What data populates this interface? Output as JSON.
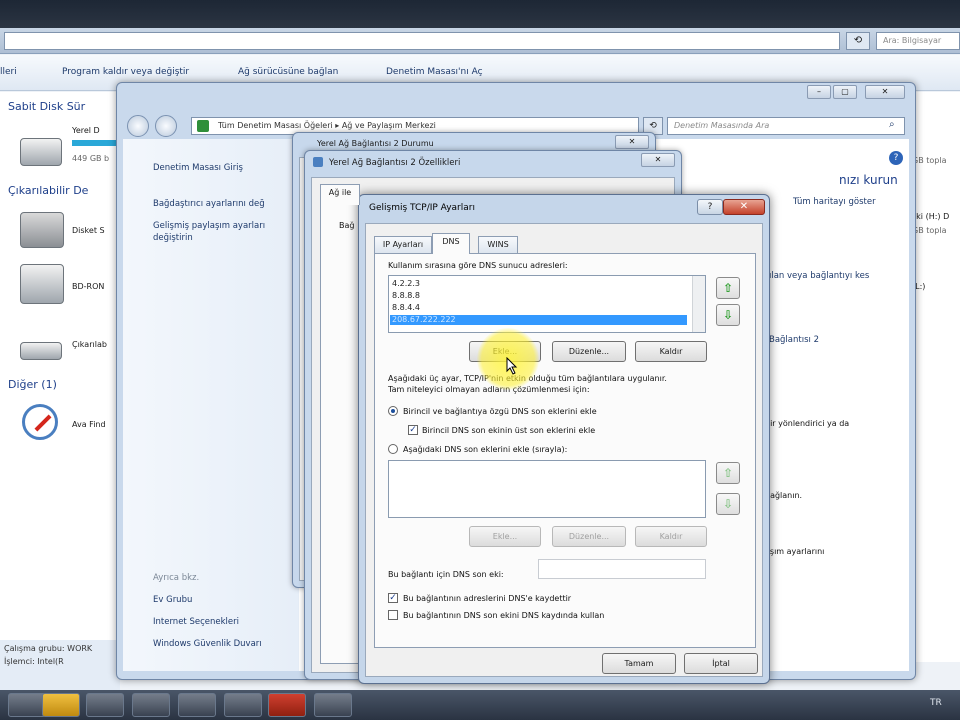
{
  "explorer": {
    "search_placeholder": "Ara: Bilgisayar",
    "refresh_icon": "⟲",
    "commands": [
      "lleri",
      "Program kaldır veya değiştir",
      "Ağ sürücüsüne bağlan",
      "Denetim Masası'nı Aç"
    ],
    "groups": {
      "hdd": "Sabit Disk Sür",
      "removable": "Çıkarılabilir De",
      "other": "Diğer (1)"
    },
    "drives": [
      {
        "label": "Yerel D",
        "sub": "449 GB b"
      },
      {
        "label": "Disket S"
      },
      {
        "label": "BD-RON"
      },
      {
        "label": "Çıkarılab"
      },
      {
        "label": "Ava Find"
      }
    ],
    "status": [
      "Çalışma grubu: WORK",
      "İşlemci: Intel(R"
    ],
    "right_texts": [
      "GB topla",
      "ski (H:) D",
      "GB topla",
      "(L:)"
    ]
  },
  "control_panel": {
    "address": "Tüm Denetim Masası Öğeleri  ▸  Ağ ve Paylaşım Merkezi",
    "search_placeholder": "Denetim Masasında Ara",
    "sidebar": {
      "home": "Denetim Masası Giriş",
      "adapter": "Bağdaştırıcı ayarlarını değ",
      "sharing": "Gelişmiş paylaşım ayarları",
      "sharing2": "değiştirin",
      "see_also": "Ayrıca bkz.",
      "home_group": "Ev Grubu",
      "internet_options": "Internet Seçenekleri",
      "firewall": "Windows Güvenlik Duvarı"
    },
    "main": {
      "heading": "nızı kurun",
      "map_link": "Tüm haritayı göster",
      "connect_link": "ılan veya bağlantıyı kes",
      "connection2": "Bağlantısı 2",
      "router": "bir yönlendirici ya da",
      "connections": "bağlanın.",
      "sharing_settings": "aşım ayarlarını"
    }
  },
  "status_window": {
    "title": "Yerel Ağ Bağlantısı 2 Durumu"
  },
  "props_window": {
    "title": "Yerel Ağ Bağlantısı 2 Özellikleri",
    "tab": "Ağ ile",
    "label": "Bağ"
  },
  "tcp": {
    "title": "Gelişmiş TCP/IP Ayarları",
    "help": "?",
    "close": "✕",
    "tabs": [
      "IP Ayarları",
      "DNS",
      "WINS"
    ],
    "dns_list_label": "Kullanım sırasına göre DNS sunucu adresleri:",
    "dns_servers": [
      "4.2.2.3",
      "8.8.8.8",
      "8.8.4.4",
      "208.67.222.222"
    ],
    "buttons": {
      "add": "Ekle...",
      "edit": "Düzenle...",
      "remove": "Kaldır"
    },
    "info_line1": "Aşağıdaki üç ayar, TCP/IP'nin etkin olduğu tüm bağlantılara uygulanır.",
    "info_line2": "Tam niteleyici olmayan adların çözümlenmesi için:",
    "radio1": "Birincil ve bağlantıya özgü DNS son eklerini ekle",
    "check_parent": "Birincil DNS son ekinin üst son eklerini ekle",
    "radio2": "Aşağıdaki DNS son eklerini ekle (sırayla):",
    "suffix_label": "Bu bağlantı için DNS son eki:",
    "register": "Bu bağlantının adreslerini DNS'e kaydettir",
    "use_suffix": "Bu bağlantının DNS son ekini DNS kaydında kullan",
    "ok": "Tamam",
    "cancel": "İptal",
    "up_icon": "⇧",
    "down_icon": "⇩"
  },
  "taskbar": {
    "lang": "TR"
  }
}
